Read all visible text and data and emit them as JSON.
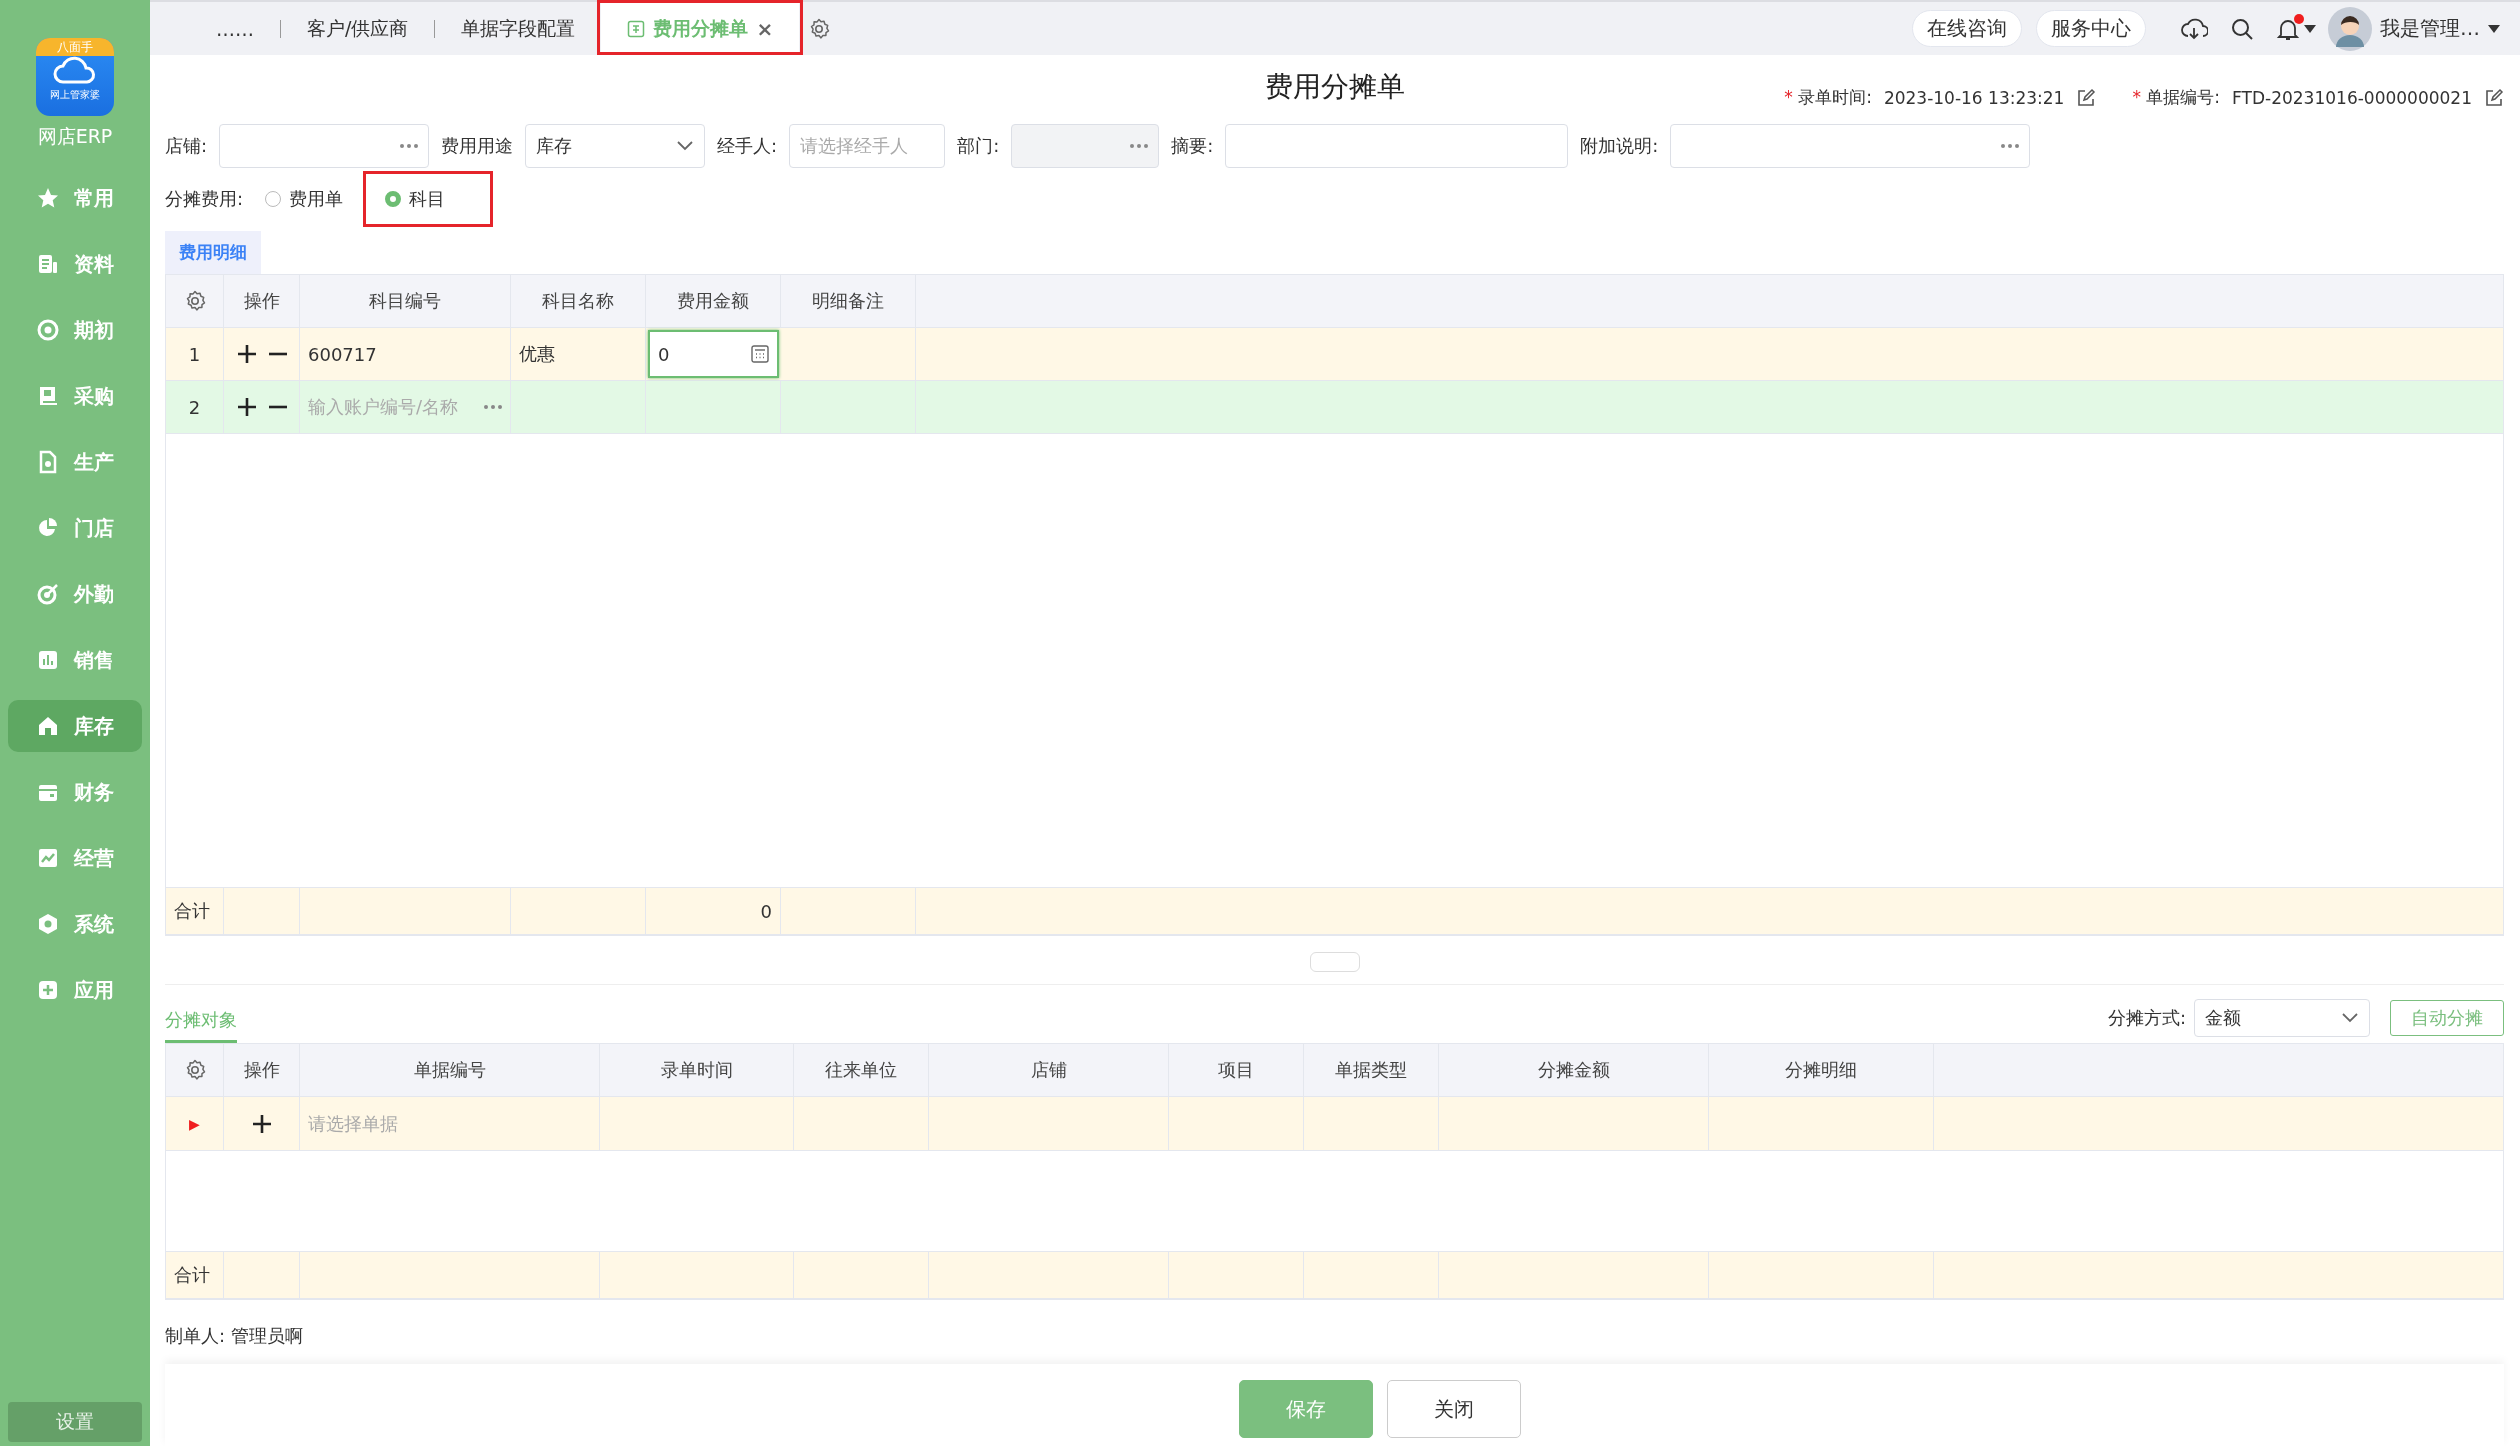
{
  "sidebar": {
    "logo_badge": "八面手",
    "logo_caption": "网上管家婆",
    "app_name": "网店ERP",
    "items": [
      {
        "label": "常用",
        "selected": false
      },
      {
        "label": "资料",
        "selected": false
      },
      {
        "label": "期初",
        "selected": false
      },
      {
        "label": "采购",
        "selected": false
      },
      {
        "label": "生产",
        "selected": false
      },
      {
        "label": "门店",
        "selected": false
      },
      {
        "label": "外勤",
        "selected": false
      },
      {
        "label": "销售",
        "selected": false
      },
      {
        "label": "库存",
        "selected": true
      },
      {
        "label": "财务",
        "selected": false
      },
      {
        "label": "经营",
        "selected": false
      },
      {
        "label": "系统",
        "selected": false
      },
      {
        "label": "应用",
        "selected": false
      }
    ],
    "settings": "设置"
  },
  "tabs": [
    {
      "label": "……",
      "selected": false,
      "highlighted": false
    },
    {
      "label": "客户/供应商",
      "selected": false,
      "highlighted": false
    },
    {
      "label": "单据字段配置",
      "selected": false,
      "highlighted": false
    },
    {
      "label": "费用分摊单",
      "selected": true,
      "highlighted": true,
      "close": "×"
    }
  ],
  "header_buttons": [
    "在线咨询",
    "服务中心"
  ],
  "notifications": {
    "unread": true
  },
  "user": {
    "name": "我是管理…"
  },
  "form": {
    "title": "费用分摊单",
    "meta": [
      {
        "required": "*",
        "label": "录单时间:",
        "value": "2023-10-16 13:23:21"
      },
      {
        "required": "*",
        "label": "单据编号:",
        "value": "FTD-20231016-0000000021"
      }
    ],
    "fields": [
      {
        "label": "店铺:",
        "kind": "picker",
        "disabled": false
      },
      {
        "label": "费用用途",
        "kind": "select",
        "value": "库存",
        "disabled": false
      },
      {
        "label": "经手人:",
        "kind": "text",
        "placeholder": "请选择经手人",
        "disabled": false
      },
      {
        "label": "部门:",
        "kind": "picker",
        "disabled": true
      },
      {
        "label": "摘要:",
        "kind": "text",
        "disabled": false
      },
      {
        "label": "附加说明:",
        "kind": "picker",
        "disabled": false
      }
    ],
    "allocation": {
      "label": "分摊费用:",
      "options": [
        {
          "label": "费用单",
          "selected": false,
          "highlighted": false
        },
        {
          "label": "科目",
          "selected": true,
          "highlighted": true
        }
      ]
    }
  },
  "detail": {
    "tab": "费用明细",
    "columns": [
      "操作",
      "科目编号",
      "科目名称",
      "费用金额",
      "明细备注"
    ],
    "rows": [
      {
        "index": "1",
        "code": "600717",
        "name": "优惠",
        "amount": "0",
        "editing": true,
        "selected": false
      },
      {
        "index": "2",
        "placeholder": "输入账户编号/名称",
        "editing": false,
        "selected": true
      }
    ],
    "total_label": "合计",
    "total_amount": "0"
  },
  "targets": {
    "tab": "分摊对象",
    "method_label": "分摊方式:",
    "method": "金额",
    "auto_button": "自动分摊",
    "columns": [
      "操作",
      "单据编号",
      "录单时间",
      "往来单位",
      "店铺",
      "项目",
      "单据类型",
      "分摊金额",
      "分摊明细"
    ],
    "rows": [
      {
        "marker": "▶",
        "placeholder": "请选择单据"
      }
    ],
    "total_label": "合计"
  },
  "creator": {
    "label": "制单人:",
    "value": "管理员啊"
  },
  "buttons": [
    {
      "label": "保存",
      "kind": "primary"
    },
    {
      "label": "关闭",
      "kind": "default"
    }
  ]
}
